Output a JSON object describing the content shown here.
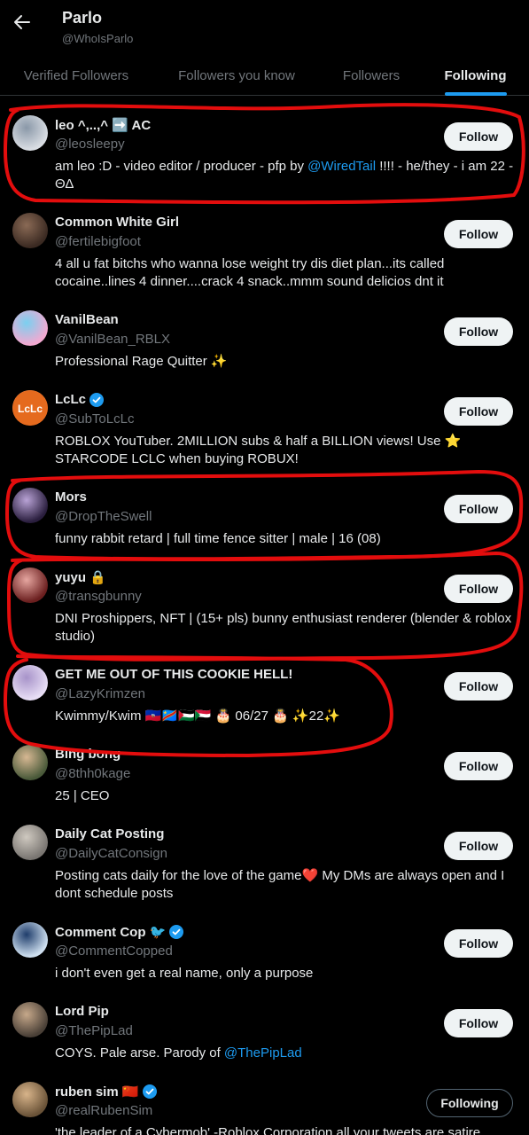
{
  "header": {
    "title": "Parlo",
    "handle": "@WhoIsParlo"
  },
  "tabs": [
    {
      "label": "Verified Followers"
    },
    {
      "label": "Followers you know"
    },
    {
      "label": "Followers"
    },
    {
      "label": "Following"
    }
  ],
  "active_tab": "Following",
  "accent_color": "#1d9bf0",
  "users": [
    {
      "name": "leo ^,..,^ ➡️ AC",
      "handle": "@leosleepy",
      "bio_pre": "am leo :D - video editor / producer - pfp by ",
      "bio_link": "@WiredTail",
      "bio_post": " !!!! - he/they - i am 22 - ΘΔ",
      "button": "Follow",
      "avatar_icon": "white-fox-avatar"
    },
    {
      "name": "Common White Girl",
      "handle": "@fertilebigfoot",
      "bio_pre": "4 all u fat bitchs who wanna lose weight try dis diet plan...its called cocaine..lines 4 dinner....crack 4 snack..mmm sound delicios dnt it",
      "button": "Follow",
      "avatar_icon": "person-avatar"
    },
    {
      "name": "VanilBean",
      "handle": "@VanilBean_RBLX",
      "bio_pre": "Professional Rage Quitter ✨",
      "button": "Follow",
      "avatar_icon": "pink-anime-avatar"
    },
    {
      "name": "LcLc",
      "handle": "@SubToLcLc",
      "bio_pre": "ROBLOX YouTuber. 2MILLION subs & half a BILLION views! Use ⭐ STARCODE LCLC when buying ROBUX!",
      "button": "Follow",
      "verified": true,
      "avatar_icon": "lclc-logo-avatar"
    },
    {
      "name": "Mors",
      "handle": "@DropTheSwell",
      "bio_pre": "funny rabbit retard | full time fence sitter | male | 16 (08)",
      "button": "Follow",
      "avatar_icon": "purple-character-avatar"
    },
    {
      "name": "yuyu 🔒",
      "handle": "@transgbunny",
      "bio_pre": "DNI Proshippers, NFT | (15+ pls) bunny enthusiast renderer (blender & roblox studio)",
      "button": "Follow",
      "avatar_icon": "red-character-avatar"
    },
    {
      "name": "GET ME OUT OF THIS COOKIE HELL!",
      "handle": "@LazyKrimzen",
      "bio_pre": "Kwimmy/Kwim 🇭🇹🇨🇩🇵🇸🇸🇩 🎂 06/27 🎂 ✨22✨",
      "button": "Follow",
      "avatar_icon": "lavender-character-avatar"
    },
    {
      "name": "Bing bong",
      "handle": "@8thh0kage",
      "bio_pre": "25 | CEO",
      "button": "Follow",
      "avatar_icon": "anime-character-avatar"
    },
    {
      "name": "Daily Cat Posting",
      "handle": "@DailyCatConsign",
      "bio_pre": "Posting cats daily for the love of the game❤️ My DMs are always open and I dont schedule posts",
      "button": "Follow",
      "avatar_icon": "cat-avatar"
    },
    {
      "name": "Comment Cop 🐦",
      "handle": "@CommentCopped",
      "bio_pre": "i don't even get a real name, only a purpose",
      "button": "Follow",
      "verified": true,
      "avatar_icon": "police-avatar"
    },
    {
      "name": "Lord Pip",
      "handle": "@ThePipLad",
      "bio_pre": "COYS. Pale arse. Parody of ",
      "bio_link": "@ThePipLad",
      "button": "Follow",
      "avatar_icon": "man-avatar"
    },
    {
      "name": "ruben sim 🇨🇳",
      "handle": "@realRubenSim",
      "bio_pre": "'the leader of a Cybermob' -Roblox Corporation all your tweets are satire",
      "button": "Following",
      "verified": true,
      "avatar_icon": "ruben-avatar"
    }
  ]
}
